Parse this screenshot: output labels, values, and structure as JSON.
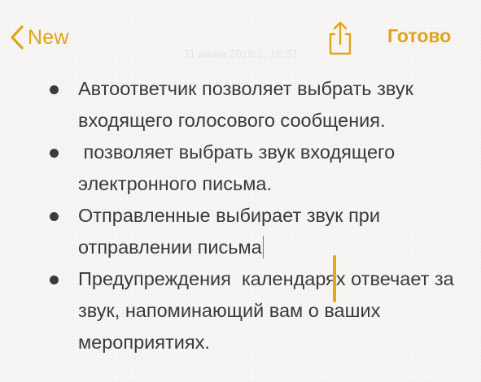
{
  "header": {
    "back_label": "New",
    "done_label": "Готово",
    "date_text": "31 июня 2018 г., 16:51"
  },
  "note": {
    "items": [
      {
        "text": "Автоответчик позволяет выбрать звук входящего голосового сообщения."
      },
      {
        "text": " позволяет выбрать звук входящего электронного письма."
      },
      {
        "text": "Отправленные выбирает звук при отправлении письма"
      },
      {
        "text": "Предупреждения  календарях отвечает за звук, напоминающий вам о ваших мероприятиях."
      }
    ]
  },
  "colors": {
    "accent": "#e0a419",
    "text": "#3a3a3a",
    "background": "#f7f6f4"
  },
  "icons": {
    "back": "chevron-left-icon",
    "share": "share-icon"
  }
}
